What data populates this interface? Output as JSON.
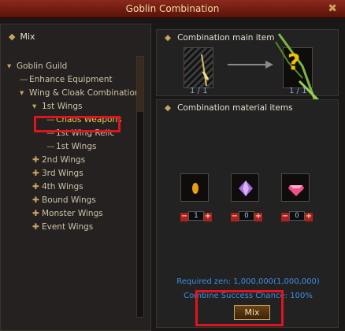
{
  "window": {
    "title": "Goblin Combination",
    "close_label": "✖"
  },
  "left_panel": {
    "header": "Mix",
    "tree": [
      {
        "arrow": "▾",
        "label": "Goblin Guild"
      },
      {
        "arrow": "—",
        "label": "Enhance Equipment"
      },
      {
        "arrow": "▾",
        "label": "Wing & Cloak Combinations"
      },
      {
        "arrow": "▾",
        "label": "1st Wings"
      },
      {
        "arrow": "—",
        "label": "Chaos Weapons"
      },
      {
        "arrow": "—",
        "label": "1st Wing Relic"
      },
      {
        "arrow": "—",
        "label": "1st Wings"
      },
      {
        "arrow": "✚",
        "label": "2nd Wings"
      },
      {
        "arrow": "✚",
        "label": "3rd Wings"
      },
      {
        "arrow": "✚",
        "label": "4th Wings"
      },
      {
        "arrow": "✚",
        "label": "Bound Wings"
      },
      {
        "arrow": "✚",
        "label": "Monster Wings"
      },
      {
        "arrow": "✚",
        "label": "Event Wings"
      }
    ]
  },
  "main_item": {
    "title": "Combination main item",
    "source_count": "1 / 1",
    "result_count": "1 / 1",
    "result_unknown": "?"
  },
  "materials": {
    "title": "Combination material items",
    "items": [
      {
        "name": "orange-gem",
        "value": "1",
        "minus": "−",
        "plus": "+"
      },
      {
        "name": "purple-gem",
        "value": "0",
        "minus": "−",
        "plus": "+"
      },
      {
        "name": "pink-gem",
        "value": "0",
        "minus": "−",
        "plus": "+"
      }
    ],
    "required_zen": "Required zen: 1,000,000(1,000,000)",
    "success_chance": "Combine Success Chance: 100%",
    "mix_button": "Mix"
  }
}
